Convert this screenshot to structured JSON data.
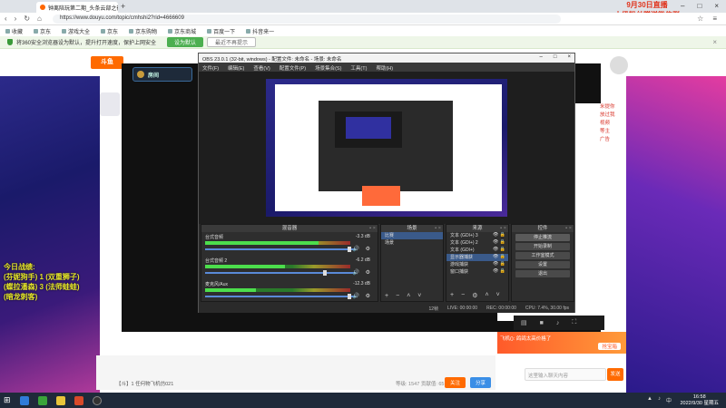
{
  "browser": {
    "tab_title": "钟离陪玩第二期_头条云部之行",
    "url": "https://www.douyu.com/topic/cmhshi2?rid=4666609",
    "top_banner_line1": "9月30日直播",
    "top_banner_line2": "十级粉丝赠送微信群",
    "bookmarks": [
      "收藏",
      "京东",
      "游戏大全",
      "京东",
      "京东购物",
      "京东商城",
      "百度一下",
      "抖音来一"
    ],
    "notice_text": "将360安全浏览器设为默认，提升打开速度，保护上网安全",
    "notice_btn_primary": "设为默认",
    "notice_btn_secondary": "最近不再提示"
  },
  "page": {
    "logo_text": "斗鱼",
    "room_label": "房间",
    "stats_title": "今日战绩:",
    "stats_lines": [
      "(芬妮狗手) 1 (双重狮子)",
      "(蝶拉潘森) 3 (法师蛙蛙)",
      "(暗龙刺客)"
    ],
    "chat_messages": [
      "米提你",
      "",
      "",
      "放过我",
      "",
      "",
      "",
      "视频",
      "",
      "",
      "",
      "等主",
      "",
      "",
      "",
      "广告",
      ""
    ],
    "gift_banner_text": "飞机(): 鸽鸽太高价格了",
    "gift_btn": "抢宝箱",
    "chat_placeholder": "这里输入聊天内容",
    "send_label": "发送",
    "under_item": "【斗】1 任何物飞机仿021",
    "under_count": "等级: 1547  贡献值: 65",
    "follow_label": "关注",
    "share_label": "分享"
  },
  "obs": {
    "title": "OBS 23.0.1 (32-bit, windows) - 配置文件: 未命名 - 场景: 未命名",
    "menu": [
      "文件(F)",
      "编辑(E)",
      "查看(V)",
      "配置文件(P)",
      "场景集合(S)",
      "工具(T)",
      "帮助(H)"
    ],
    "mixer_title": "混音器",
    "channels": [
      {
        "name": "台式音频",
        "db": "-3.3 dB",
        "level": 0.78,
        "volume": 0.98
      },
      {
        "name": "台式音频 2",
        "db": "-6.2 dB",
        "level": 0.55,
        "volume": 0.82
      },
      {
        "name": "麦克风/Aux",
        "db": "-12.3 dB",
        "level": 0.35,
        "volume": 0.98
      }
    ],
    "scenes_title": "场景",
    "scenes": [
      "比赛",
      "场景"
    ],
    "sources_title": "来源",
    "sources": [
      "文本 (GDI+) 3",
      "文本 (GDI+) 2",
      "文本 (GDI+)",
      "显示器捕获",
      "游戏捕获",
      "窗口捕获"
    ],
    "controls_title": "控件",
    "controls": [
      "停止推流",
      "开始录制",
      "工作室模式",
      "设置",
      "退出"
    ],
    "status": {
      "live": "LIVE: 00:00:00",
      "rec": "REC: 00:00:00",
      "cpu": "CPU: 7.4%, 30.00 fps",
      "fps_drop": "12帧"
    }
  },
  "taskbar": {
    "time": "16:58",
    "date": "2022/9/30 星期五"
  }
}
